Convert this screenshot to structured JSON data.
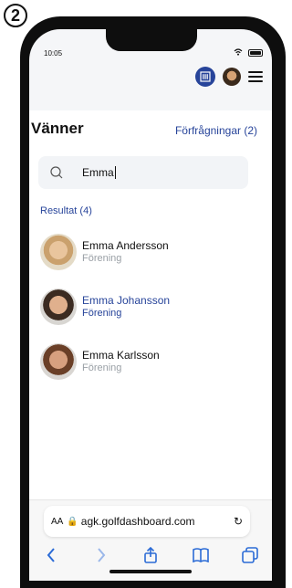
{
  "step_badge": "2",
  "status_bar": {
    "time": "10:05"
  },
  "page": {
    "title": "Vänner",
    "requests_link": "Förfrågningar (2)",
    "search_value": "Emma",
    "results_label": "Resultat (4)",
    "results": [
      {
        "name": "Emma Andersson",
        "subtitle": "Förening",
        "highlighted": false
      },
      {
        "name": "Emma Johansson",
        "subtitle": "Förening",
        "highlighted": true
      },
      {
        "name": "Emma Karlsson",
        "subtitle": "Förening",
        "highlighted": false
      }
    ]
  },
  "browser": {
    "aa_label": "AA",
    "domain": "agk.golfdashboard.com",
    "reload_symbol": "↻"
  },
  "colors": {
    "accent": "#27449a",
    "muted": "#9aa0a6",
    "toolbar_blue": "#2b6bd6"
  },
  "icons": {
    "qr": "qr-code-icon",
    "menu": "hamburger-menu-icon",
    "search": "search-icon",
    "lock": "lock-icon",
    "reload": "reload-icon",
    "back": "chevron-left-icon",
    "forward": "chevron-right-icon",
    "share": "share-icon",
    "bookmarks": "book-icon",
    "tabs": "tabs-icon"
  }
}
